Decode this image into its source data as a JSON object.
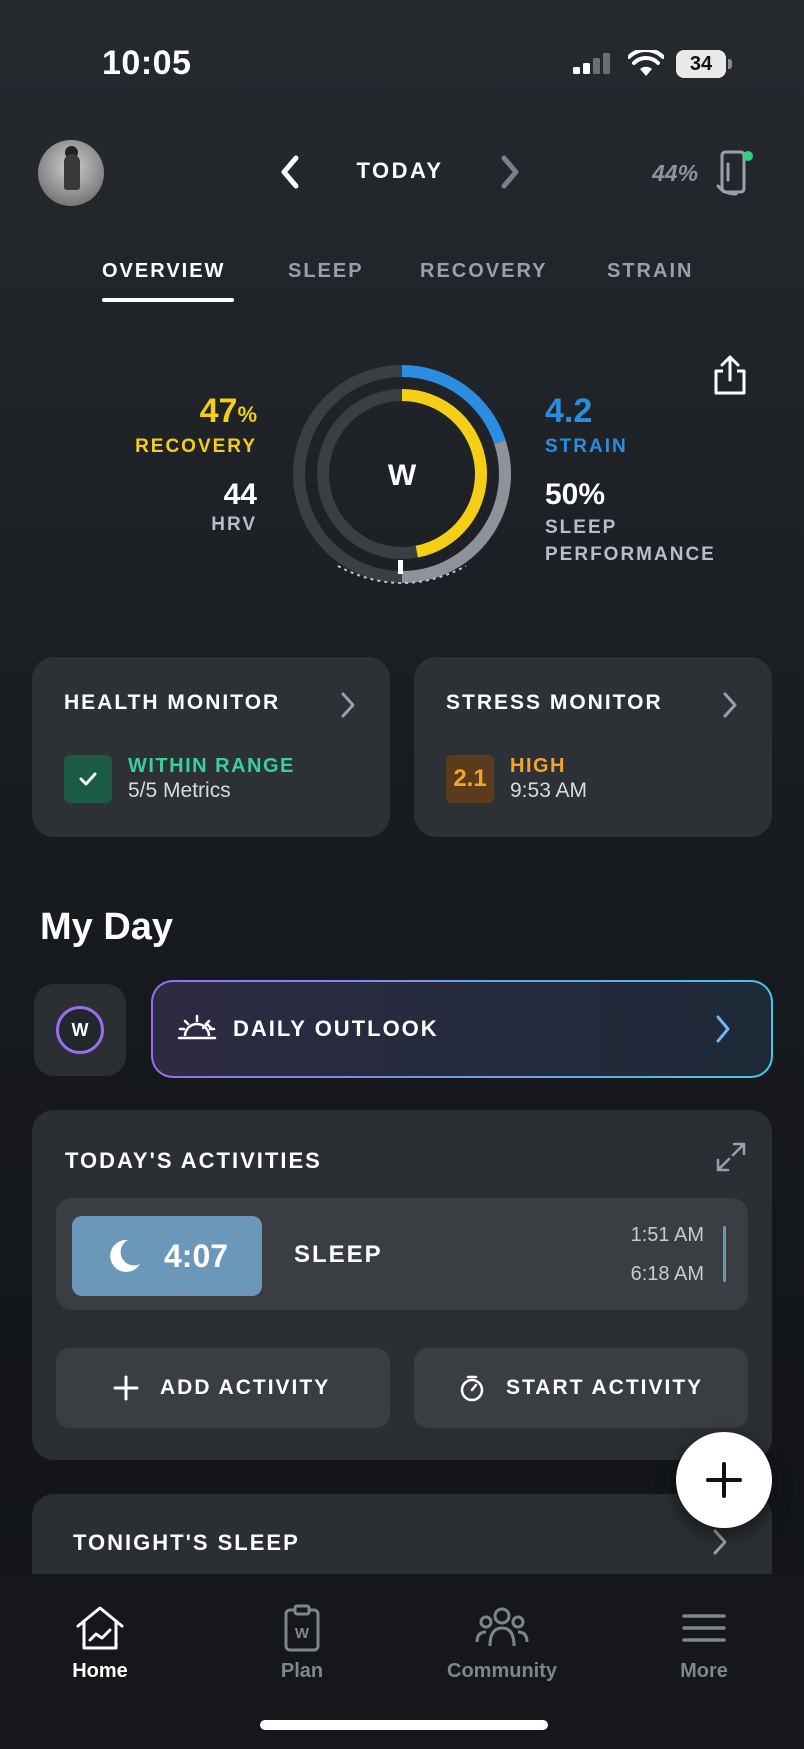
{
  "status_bar": {
    "time": "10:05",
    "battery": "34"
  },
  "header": {
    "date_label": "TODAY",
    "device_battery": "44%"
  },
  "tabs": [
    {
      "label": "OVERVIEW",
      "active": true
    },
    {
      "label": "SLEEP",
      "active": false
    },
    {
      "label": "RECOVERY",
      "active": false
    },
    {
      "label": "STRAIN",
      "active": false
    }
  ],
  "overview": {
    "recovery_value": "47",
    "recovery_unit": "%",
    "recovery_label": "RECOVERY",
    "hrv_value": "44",
    "hrv_label": "HRV",
    "strain_value": "4.2",
    "strain_label": "STRAIN",
    "sleep_perf_value": "50%",
    "sleep_perf_label": "SLEEP PERFORMANCE",
    "logo": "W",
    "recovery_fraction": 0.47,
    "strain_fraction": 0.2,
    "sleep_fraction": 0.5,
    "colors": {
      "recovery": "#f5cf16",
      "strain": "#2a8de0",
      "track": "#3b3f44"
    }
  },
  "health_monitor": {
    "title": "HEALTH MONITOR",
    "status": "WITHIN RANGE",
    "detail": "5/5 Metrics",
    "status_color": "#34d399"
  },
  "stress_monitor": {
    "title": "STRESS MONITOR",
    "score": "2.1",
    "status": "HIGH",
    "time": "9:53 AM",
    "status_color": "#f3a52a"
  },
  "my_day": {
    "heading": "My Day",
    "outlook_label": "DAILY OUTLOOK",
    "whoop_icon": "W"
  },
  "activities": {
    "title": "TODAY'S ACTIVITIES",
    "sleep": {
      "duration": "4:07",
      "name": "SLEEP",
      "start": "1:51 AM",
      "end": "6:18 AM"
    },
    "add_label": "ADD ACTIVITY",
    "start_label": "START ACTIVITY"
  },
  "tonight": {
    "title": "TONIGHT'S SLEEP"
  },
  "bottom_nav": [
    {
      "label": "Home",
      "icon": "home-icon",
      "active": true
    },
    {
      "label": "Plan",
      "icon": "clipboard-icon",
      "active": false
    },
    {
      "label": "Community",
      "icon": "people-icon",
      "active": false
    },
    {
      "label": "More",
      "icon": "menu-icon",
      "active": false
    }
  ]
}
